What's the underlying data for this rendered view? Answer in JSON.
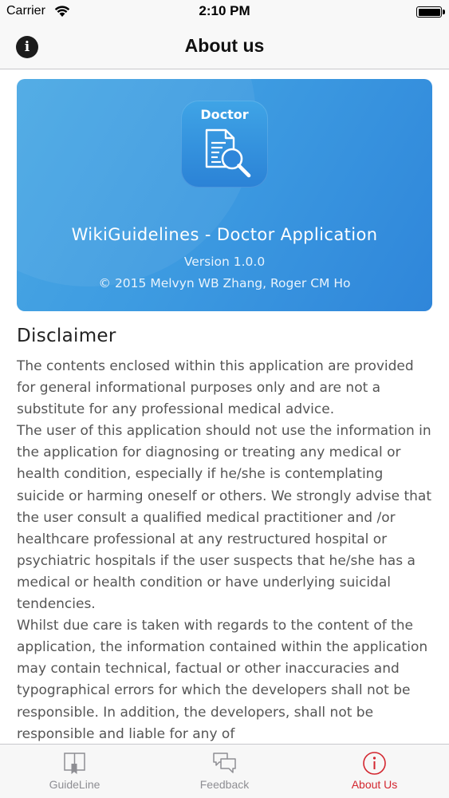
{
  "status_bar": {
    "carrier": "Carrier",
    "time": "2:10 PM",
    "battery_percent": 100
  },
  "nav": {
    "title": "About us",
    "info_icon": "info-circle-icon"
  },
  "banner": {
    "icon_label": "Doctor",
    "icon": "document-search-icon",
    "title": "WikiGuidelines - Doctor Application",
    "version": "Version 1.0.0",
    "copyright": "© 2015 Melvyn WB Zhang, Roger CM Ho",
    "background_color": "#3d9be1"
  },
  "disclaimer": {
    "heading": "Disclaimer",
    "paragraphs": [
      "The contents enclosed within this application are provided for general informational purposes only and are not a substitute for any professional medical advice.",
      "The user of this application should not use the information in the application for diagnosing or treating any medical or health condition, especially if he/she is contemplating suicide or harming oneself or others. We strongly advise that the user consult a qualified medical practitioner and /or healthcare professional at any restructured hospital or psychiatric hospitals if the user suspects that he/she has a medical or health condition or have underlying suicidal tendencies.",
      "Whilst due care is taken with regards to the content of the application, the information contained within the application may contain technical, factual or other inaccuracies and typographical errors for which the developers shall not be responsible. In addition, the developers, shall not be responsible and liable for any of"
    ]
  },
  "tab_bar": {
    "tabs": [
      {
        "label": "GuideLine",
        "icon": "book-icon",
        "active": false
      },
      {
        "label": "Feedback",
        "icon": "chat-bubbles-icon",
        "active": false
      },
      {
        "label": "About Us",
        "icon": "info-circle-icon",
        "active": true
      }
    ],
    "active_color": "#d3262f",
    "inactive_color": "#8e8e93"
  }
}
